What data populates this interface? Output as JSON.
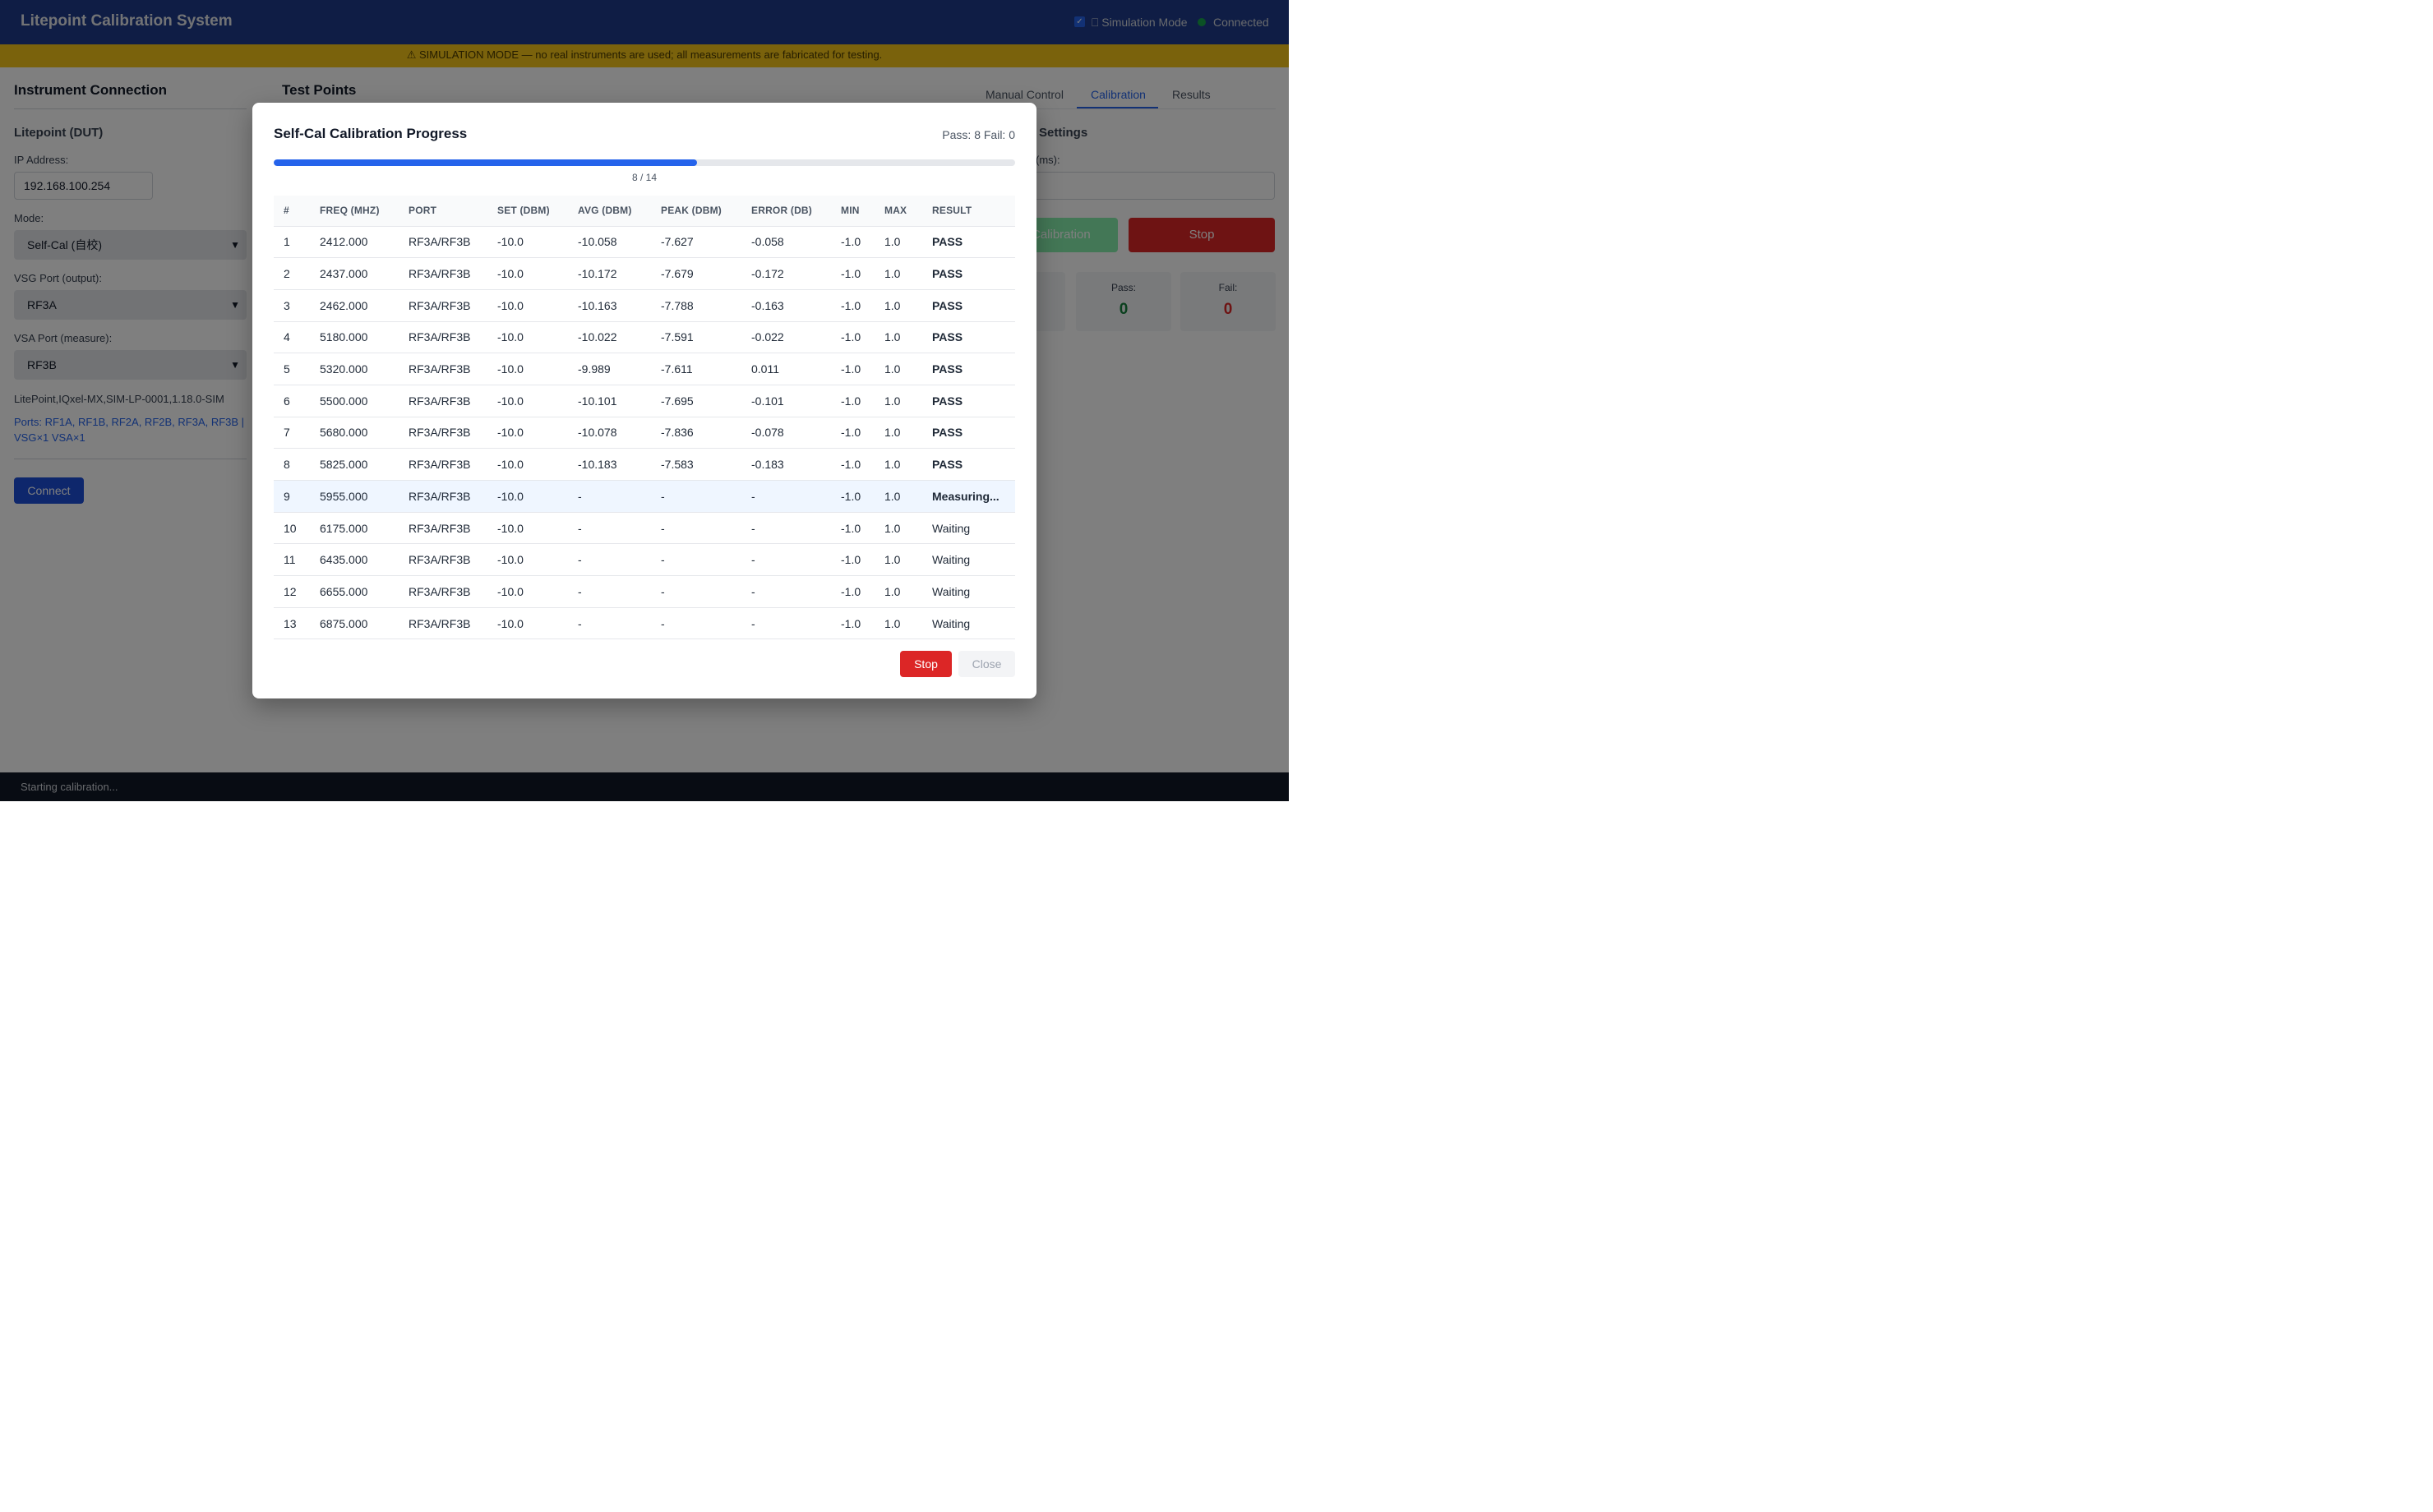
{
  "header": {
    "title": "Litepoint Calibration System",
    "simulation_label": "⎕ Simulation Mode",
    "connection_label": "Connected"
  },
  "banner": {
    "text": "⚠ SIMULATION MODE — no real instruments are used; all measurements are fabricated for testing."
  },
  "instrument": {
    "title": "Instrument Connection",
    "subtitle": "Litepoint (DUT)",
    "ip_label": "IP Address:",
    "ip_value": "192.168.100.254",
    "mode_label": "Mode:",
    "mode_value": "Self-Cal (自校)",
    "vsg_label": "VSG Port (output):",
    "vsg_value": "RF3A",
    "vsa_label": "VSA Port (measure):",
    "vsa_value": "RF3B",
    "idn": "LitePoint,IQxel-MX,SIM-LP-0001,1.18.0-SIM",
    "ports": "Ports: RF1A, RF1B, RF2A, RF2B, RF3A, RF3B | VSG×1 VSA×1",
    "connect_label": "Connect"
  },
  "test_points": {
    "title": "Test Points"
  },
  "right": {
    "tabs": [
      {
        "label": "Manual Control",
        "active": false
      },
      {
        "label": "Calibration",
        "active": true
      },
      {
        "label": "Results",
        "active": false
      }
    ],
    "settings_title": "Settings",
    "field_label": "(ms):",
    "start_label": "Calibration",
    "stop_label": "Stop",
    "stats": [
      {
        "label": "Pass:",
        "value": "0",
        "color": "#15803d"
      },
      {
        "label": "Fail:",
        "value": "0",
        "color": "#dc2626"
      }
    ]
  },
  "status": {
    "text": "Starting calibration..."
  },
  "modal": {
    "title": "Self-Cal Calibration Progress",
    "counts": "Pass: 8 Fail: 0",
    "progress": {
      "done": 8,
      "total": 14,
      "text": "8 / 14"
    },
    "columns": [
      "#",
      "FREQ (MHZ)",
      "PORT",
      "SET (DBM)",
      "AVG (DBM)",
      "PEAK (DBM)",
      "ERROR (DB)",
      "MIN",
      "MAX",
      "RESULT"
    ],
    "rows": [
      {
        "n": "1",
        "freq": "2412.000",
        "port": "RF3A/RF3B",
        "set": "-10.0",
        "avg": "-10.058",
        "peak": "-7.627",
        "err": "-0.058",
        "min": "-1.0",
        "max": "1.0",
        "result": "PASS",
        "state": "pass"
      },
      {
        "n": "2",
        "freq": "2437.000",
        "port": "RF3A/RF3B",
        "set": "-10.0",
        "avg": "-10.172",
        "peak": "-7.679",
        "err": "-0.172",
        "min": "-1.0",
        "max": "1.0",
        "result": "PASS",
        "state": "pass"
      },
      {
        "n": "3",
        "freq": "2462.000",
        "port": "RF3A/RF3B",
        "set": "-10.0",
        "avg": "-10.163",
        "peak": "-7.788",
        "err": "-0.163",
        "min": "-1.0",
        "max": "1.0",
        "result": "PASS",
        "state": "pass"
      },
      {
        "n": "4",
        "freq": "5180.000",
        "port": "RF3A/RF3B",
        "set": "-10.0",
        "avg": "-10.022",
        "peak": "-7.591",
        "err": "-0.022",
        "min": "-1.0",
        "max": "1.0",
        "result": "PASS",
        "state": "pass"
      },
      {
        "n": "5",
        "freq": "5320.000",
        "port": "RF3A/RF3B",
        "set": "-10.0",
        "avg": "-9.989",
        "peak": "-7.611",
        "err": "0.011",
        "min": "-1.0",
        "max": "1.0",
        "result": "PASS",
        "state": "pass"
      },
      {
        "n": "6",
        "freq": "5500.000",
        "port": "RF3A/RF3B",
        "set": "-10.0",
        "avg": "-10.101",
        "peak": "-7.695",
        "err": "-0.101",
        "min": "-1.0",
        "max": "1.0",
        "result": "PASS",
        "state": "pass"
      },
      {
        "n": "7",
        "freq": "5680.000",
        "port": "RF3A/RF3B",
        "set": "-10.0",
        "avg": "-10.078",
        "peak": "-7.836",
        "err": "-0.078",
        "min": "-1.0",
        "max": "1.0",
        "result": "PASS",
        "state": "pass"
      },
      {
        "n": "8",
        "freq": "5825.000",
        "port": "RF3A/RF3B",
        "set": "-10.0",
        "avg": "-10.183",
        "peak": "-7.583",
        "err": "-0.183",
        "min": "-1.0",
        "max": "1.0",
        "result": "PASS",
        "state": "pass"
      },
      {
        "n": "9",
        "freq": "5955.000",
        "port": "RF3A/RF3B",
        "set": "-10.0",
        "avg": "-",
        "peak": "-",
        "err": "-",
        "min": "-1.0",
        "max": "1.0",
        "result": "Measuring...",
        "state": "measuring"
      },
      {
        "n": "10",
        "freq": "6175.000",
        "port": "RF3A/RF3B",
        "set": "-10.0",
        "avg": "-",
        "peak": "-",
        "err": "-",
        "min": "-1.0",
        "max": "1.0",
        "result": "Waiting",
        "state": "waiting"
      },
      {
        "n": "11",
        "freq": "6435.000",
        "port": "RF3A/RF3B",
        "set": "-10.0",
        "avg": "-",
        "peak": "-",
        "err": "-",
        "min": "-1.0",
        "max": "1.0",
        "result": "Waiting",
        "state": "waiting"
      },
      {
        "n": "12",
        "freq": "6655.000",
        "port": "RF3A/RF3B",
        "set": "-10.0",
        "avg": "-",
        "peak": "-",
        "err": "-",
        "min": "-1.0",
        "max": "1.0",
        "result": "Waiting",
        "state": "waiting"
      },
      {
        "n": "13",
        "freq": "6875.000",
        "port": "RF3A/RF3B",
        "set": "-10.0",
        "avg": "-",
        "peak": "-",
        "err": "-",
        "min": "-1.0",
        "max": "1.0",
        "result": "Waiting",
        "state": "waiting"
      }
    ],
    "stop_label": "Stop",
    "close_label": "Close"
  }
}
